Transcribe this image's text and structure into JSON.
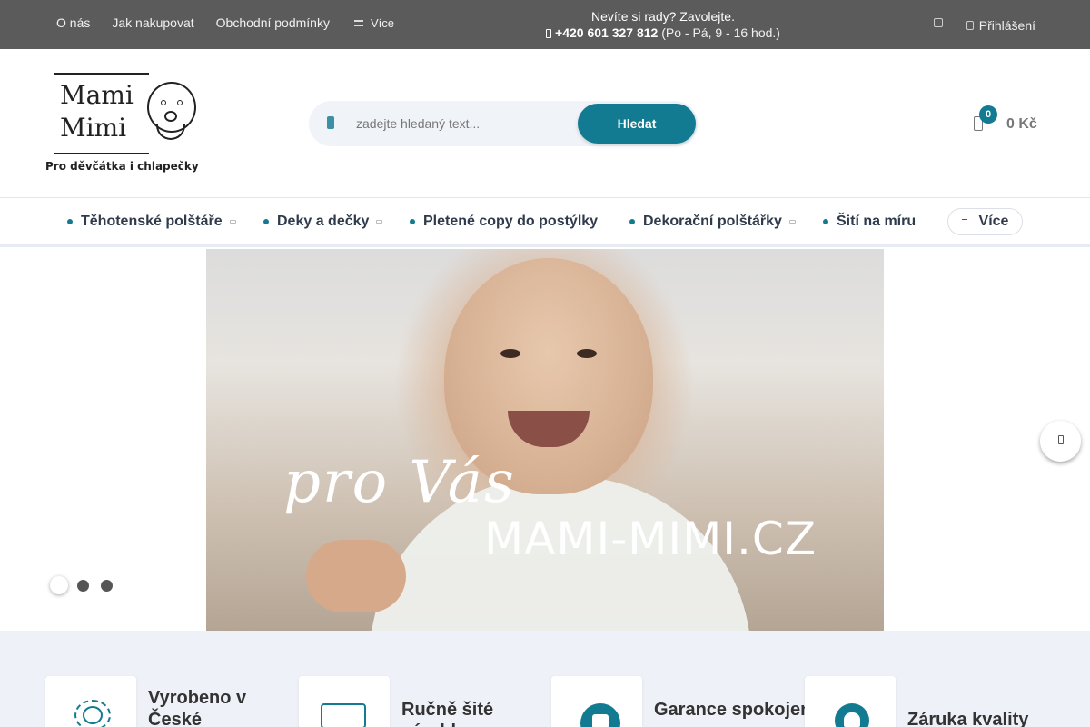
{
  "topbar": {
    "links": [
      "O nás",
      "Jak nakupovat",
      "Obchodní podmínky"
    ],
    "more_label": "Více",
    "help_text": "Nevíte si rady? Zavolejte.",
    "phone": "+420 601 327 812",
    "hours": "(Po - Pá, 9 - 16 hod.)",
    "login_label": "Přihlášení"
  },
  "logo": {
    "line1": "Mami",
    "line2": "Mimi",
    "tagline": "Pro děvčátka i chlapečky"
  },
  "search": {
    "placeholder": "zadejte hledaný text...",
    "button_label": "Hledat"
  },
  "cart": {
    "count": "0",
    "total": "0 Kč"
  },
  "nav": {
    "items": [
      {
        "label": "Těhotenské polštáře",
        "has_submenu": true
      },
      {
        "label": "Deky a dečky",
        "has_submenu": true
      },
      {
        "label": "Pletené copy do postýlky",
        "has_submenu": false
      },
      {
        "label": "Dekorační polštářky",
        "has_submenu": true
      },
      {
        "label": "Šití na míru",
        "has_submenu": false
      }
    ],
    "more_label": "Více"
  },
  "hero": {
    "script_text": "pro Vás",
    "title": "MAMI-MIMI.CZ",
    "slides": 3,
    "active_slide": 1
  },
  "benefits": [
    {
      "label": "Vyrobeno v České",
      "icon": "sun-icon"
    },
    {
      "label": "Ručně šité výrobky",
      "icon": "sewing-machine-icon"
    },
    {
      "label": "Garance spokojenosti",
      "icon": "thumbs-up-icon"
    },
    {
      "label": "Záruka kvality",
      "icon": "heart-icon"
    }
  ],
  "colors": {
    "accent": "#127a91",
    "topbar": "#5b5b5b",
    "benefits_bg": "#eef1f7"
  }
}
